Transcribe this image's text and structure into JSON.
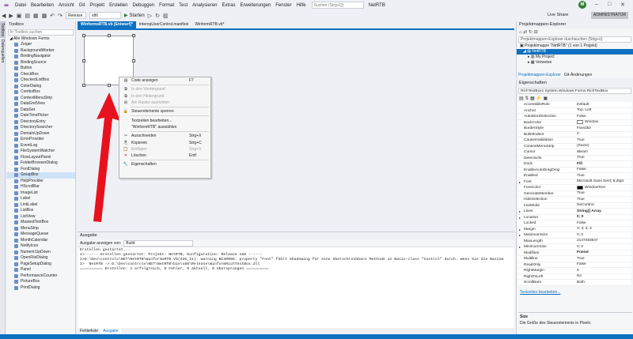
{
  "menu": {
    "items": [
      "Datei",
      "Bearbeiten",
      "Ansicht",
      "Git",
      "Projekt",
      "Erstellen",
      "Debuggen",
      "Format",
      "Test",
      "Analysieren",
      "Extras",
      "Erweiterungen",
      "Fenster",
      "Hilfe"
    ],
    "search_placeholder": "Suchen (Strg+Q)",
    "project_name": "NetRTB",
    "avatar_initial": "M"
  },
  "toolbar": {
    "config": "Release",
    "platform": "x86",
    "start_label": "Starten",
    "live_share": "Live Share",
    "admin": "ADMINISTRATOR"
  },
  "left_strip": {
    "tabs": [
      "Toolbox",
      "Datenquellen"
    ]
  },
  "toolbox": {
    "title": "Toolbox",
    "search_placeholder": "In Toolbox suchen",
    "group": "Alle Windows Forms",
    "selected": "GroupBox",
    "items": [
      "Zeiger",
      "BackgroundWorker",
      "BindingNavigator",
      "BindingSource",
      "Button",
      "CheckBox",
      "CheckedListBox",
      "ColorDialog",
      "ComboBox",
      "ContextMenuStrip",
      "DataGridView",
      "DataSet",
      "DateTimePicker",
      "DirectoryEntry",
      "DirectorySearcher",
      "DomainUpDown",
      "ErrorProvider",
      "EventLog",
      "FileSystemWatcher",
      "FlowLayoutPanel",
      "FolderBrowserDialog",
      "FontDialog",
      "GroupBox",
      "HelpProvider",
      "HScrollBar",
      "ImageList",
      "Label",
      "LinkLabel",
      "ListBox",
      "ListView",
      "MaskedTextBox",
      "MenuStrip",
      "MessageQueue",
      "MonthCalendar",
      "NotifyIcon",
      "NumericUpDown",
      "OpenFileDialog",
      "PageSetupDialog",
      "Panel",
      "PerformanceCounter",
      "PictureBox",
      "PrintDialog"
    ]
  },
  "editor_tabs": [
    "WinformsRTB.vb [Entwurf]*",
    "InteropUserControl.manifest",
    "WinformRTB.vb*"
  ],
  "context_menu": {
    "items": [
      {
        "icon": "code-icon",
        "label": "Code anzeigen",
        "shortcut": "F7",
        "disabled": false
      },
      {
        "icon": "bring-front-icon",
        "label": "In den Vordergrund",
        "shortcut": "",
        "disabled": true
      },
      {
        "icon": "send-back-icon",
        "label": "In den Hintergrund",
        "shortcut": "",
        "disabled": true
      },
      {
        "icon": "grid-align-icon",
        "label": "Am Raster ausrichten",
        "shortcut": "",
        "disabled": true
      },
      {
        "icon": "lock-icon",
        "label": "Steuerelemente sperren",
        "shortcut": "",
        "disabled": false
      },
      {
        "icon": "",
        "label": "Textzeilen bearbeiten...",
        "shortcut": "",
        "disabled": false
      },
      {
        "icon": "",
        "label": "\"WinformRTB\" auswählen",
        "shortcut": "",
        "disabled": false
      },
      {
        "icon": "cut-icon",
        "label": "Ausschneiden",
        "shortcut": "Strg+X",
        "disabled": false
      },
      {
        "icon": "copy-icon",
        "label": "Kopieren",
        "shortcut": "Strg+C",
        "disabled": false
      },
      {
        "icon": "paste-icon",
        "label": "Einfügen",
        "shortcut": "Strg+V",
        "disabled": true
      },
      {
        "icon": "delete-icon",
        "label": "Löschen",
        "shortcut": "Entf",
        "disabled": false
      },
      {
        "icon": "properties-icon",
        "label": "Eigenschaften",
        "shortcut": "",
        "disabled": false
      }
    ]
  },
  "output": {
    "title": "Ausgabe",
    "show_from_label": "Ausgabe anzeigen von:",
    "show_from_value": "Build",
    "lines": [
      "Erstellen gestartet...",
      "1>------ Erstellen gestartet: Projekt: NetRTB, Konfiguration: Release x86 ------",
      "1>D:\\Dev\\controls\\NET\\NetRTB\\WinformsRTB.vb(435,21): warning BC40005: property \"Font\" führt Shadowing für eine überschreibbare Methode in Basis-class \"Control\" durch. Wenn Sie die Basism",
      "1>  NetRTB -> D:\\Dev\\controls\\NET\\NetRTB\\bin\\x86\\Release\\WinformRichTextBox.dll",
      "========== Erstellen: 1 erfolgreich, 0 Fehler, 0 aktuell, 0 übersprungen =========="
    ],
    "tabs": [
      "Fehlerliste",
      "Ausgabe"
    ]
  },
  "solution_explorer": {
    "title": "Projektmappen-Explorer",
    "search_placeholder": "Projektmappen-Explorer durchsuchen (Strg+ü)",
    "tree": [
      "Projektmappe \"NetRTB\" (1 von 1 Projekt)",
      "NetRTB",
      "My Project",
      "Verweise"
    ],
    "tabs": [
      "Projektmappen-Explorer",
      "Git-Änderungen"
    ]
  },
  "properties": {
    "title": "Eigenschaften",
    "object": "RichTextBox1  System.Windows.Forms.RichTextBox",
    "rows": [
      {
        "name": "AccessibleRole",
        "value": "Default"
      },
      {
        "name": "Anchor",
        "value": "Top, Left"
      },
      {
        "name": "AutoWordSelection",
        "value": "False"
      },
      {
        "name": "BackColor",
        "value": "Window",
        "swatch": "#ffffff"
      },
      {
        "name": "BorderStyle",
        "value": "Fixed3D"
      },
      {
        "name": "BulletIndent",
        "value": "0"
      },
      {
        "name": "CausesValidation",
        "value": "True"
      },
      {
        "name": "ContextMenuStrip",
        "value": "(Keine)"
      },
      {
        "name": "Cursor",
        "value": "IBeam"
      },
      {
        "name": "DetectUrls",
        "value": "True"
      },
      {
        "name": "Dock",
        "value": "Fill",
        "bold": true
      },
      {
        "name": "EnableAutoDragDrop",
        "value": "False"
      },
      {
        "name": "Enabled",
        "value": "True"
      },
      {
        "name": "Font",
        "value": "Microsoft Sans Serif; 8,25pt",
        "expand": true
      },
      {
        "name": "ForeColor",
        "value": "WindowText",
        "swatch": "#000000"
      },
      {
        "name": "GenerateMember",
        "value": "True"
      },
      {
        "name": "HideSelection",
        "value": "True"
      },
      {
        "name": "ImeMode",
        "value": "NoControl"
      },
      {
        "name": "Lines",
        "value": "String[] Array",
        "expand": true,
        "bold": true
      },
      {
        "name": "Location",
        "value": "0; 0",
        "expand": true,
        "bold": true
      },
      {
        "name": "Locked",
        "value": "False"
      },
      {
        "name": "Margin",
        "value": "3; 3; 3; 3",
        "expand": true
      },
      {
        "name": "MaximumSize",
        "value": "0; 0",
        "expand": true
      },
      {
        "name": "MaxLength",
        "value": "2147483647"
      },
      {
        "name": "MinimumSize",
        "value": "0; 0",
        "expand": true
      },
      {
        "name": "Modifiers",
        "value": "Friend",
        "bold": true
      },
      {
        "name": "Multiline",
        "value": "True"
      },
      {
        "name": "ReadOnly",
        "value": "False"
      },
      {
        "name": "RightMargin",
        "value": "0"
      },
      {
        "name": "RightToLeft",
        "value": "No"
      },
      {
        "name": "ScrollBars",
        "value": "Both"
      }
    ],
    "edit_link": "Textzeilen bearbeiten...",
    "desc_title": "Size",
    "desc_text": "Die Größe des Steuerelements in Pixeln."
  },
  "colors": {
    "accent": "#0e70c0",
    "arrow": "#e8121e"
  }
}
